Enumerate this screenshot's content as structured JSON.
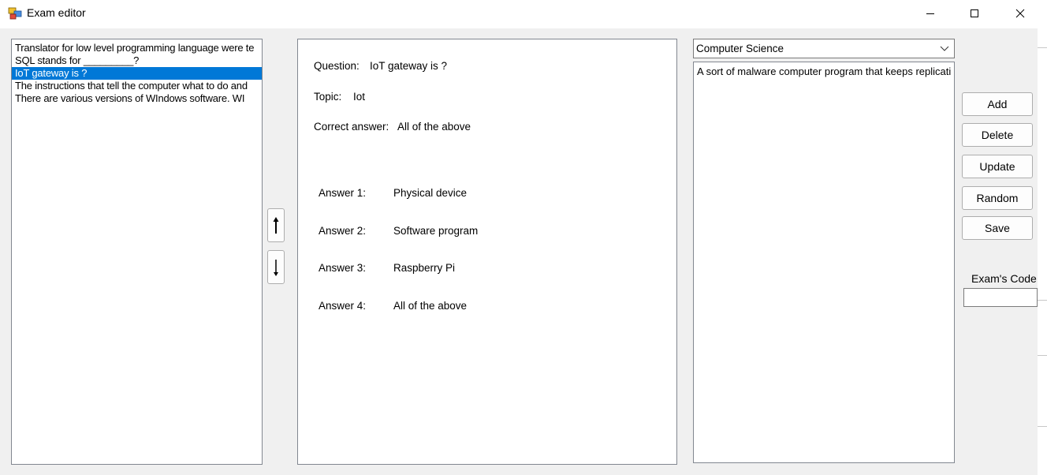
{
  "window": {
    "title": "Exam editor"
  },
  "question_list": {
    "items": [
      "Translator for low level programming language were te",
      "SQL stands for _________?",
      "IoT gateway is ?",
      "The instructions that tell the computer what to do and",
      "There are various versions of WIndows software.  WI"
    ],
    "selected_index": 2
  },
  "details": {
    "question_label": "Question:",
    "question_value": "IoT gateway is ?",
    "topic_label": "Topic:",
    "topic_value": "Iot",
    "correct_label": "Correct answer:",
    "correct_value": "All of the above",
    "answers": [
      {
        "label": "Answer 1:",
        "value": "Physical device"
      },
      {
        "label": "Answer 2:",
        "value": "Software program"
      },
      {
        "label": "Answer 3:",
        "value": "Raspberry Pi"
      },
      {
        "label": "Answer 4:",
        "value": "All of the above"
      }
    ]
  },
  "move_up_icon": "arrow-up-icon",
  "move_down_icon": "arrow-down-icon",
  "subject_select": {
    "selected": "Computer Science"
  },
  "description_list": {
    "items": [
      "A sort of malware computer program that keeps replicati"
    ]
  },
  "buttons": {
    "add": "Add",
    "delete": "Delete",
    "update": "Update",
    "random": "Random",
    "save": "Save"
  },
  "exam_code": {
    "label": "Exam's Code",
    "value": ""
  },
  "colors": {
    "selection": "#0078d7",
    "border": "#828790",
    "background": "#f0f0f0"
  }
}
